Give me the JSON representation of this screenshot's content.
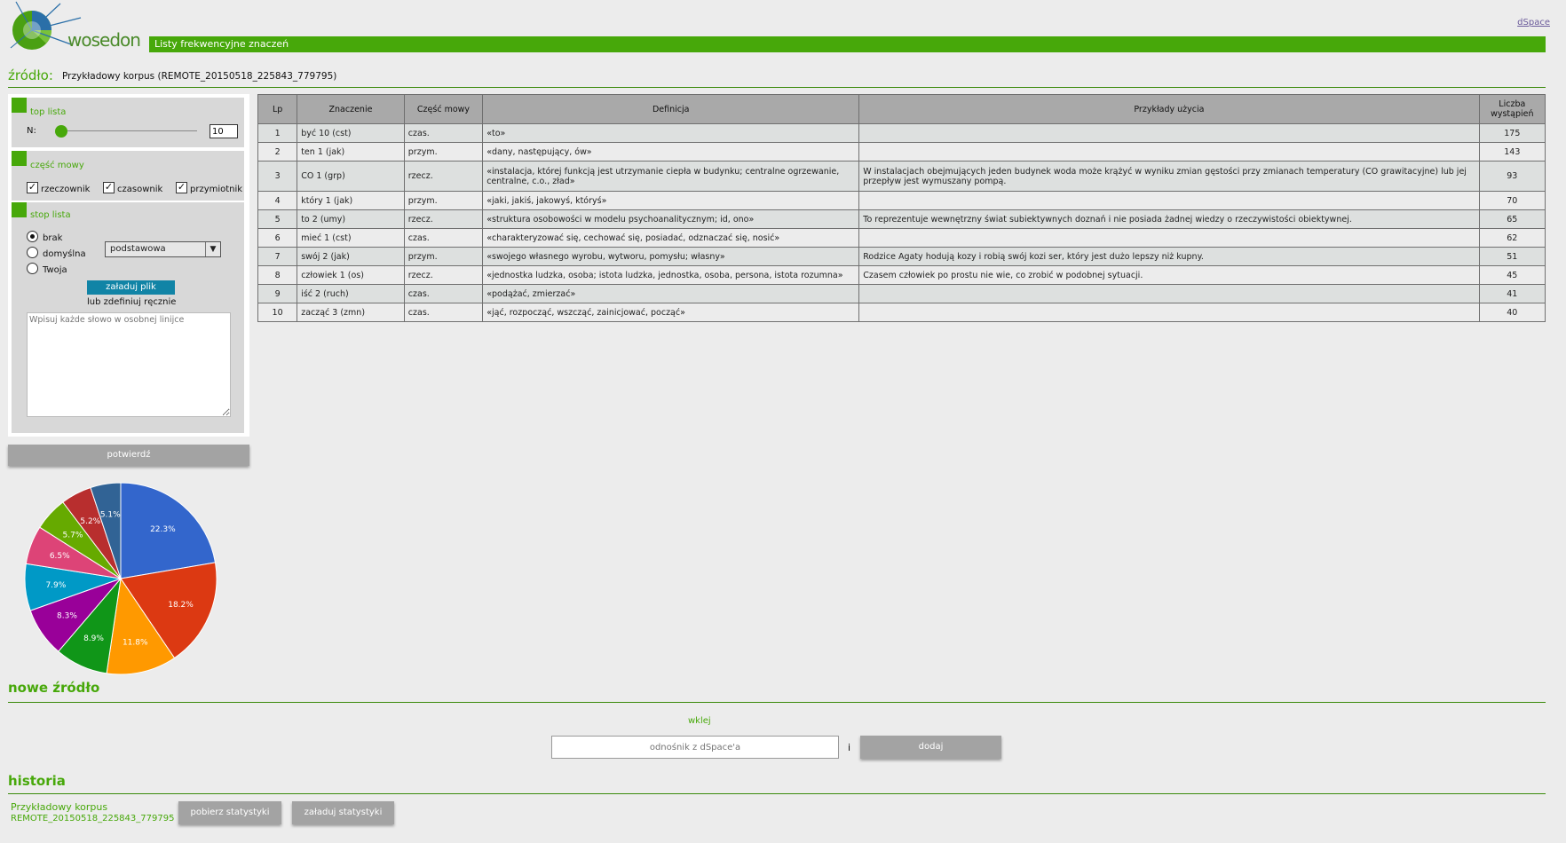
{
  "header": {
    "logo_text": "wosedon",
    "dspace_link": "dSpace",
    "title": "Listy frekwencyjne znaczeń"
  },
  "source": {
    "label": "źródło:",
    "value": "Przykładowy korpus (REMOTE_20150518_225843_779795)"
  },
  "panel": {
    "top_list": {
      "title": "top lista",
      "n_label": "N:",
      "n_value": "10",
      "slider_fraction": 0.0
    },
    "pos": {
      "title": "część mowy",
      "items": [
        {
          "label": "rzeczownik",
          "checked": true
        },
        {
          "label": "czasownik",
          "checked": true
        },
        {
          "label": "przymiotnik",
          "checked": true
        }
      ]
    },
    "stop_list": {
      "title": "stop lista",
      "options": [
        "brak",
        "domyślna",
        "Twoja"
      ],
      "selected": "brak",
      "select_value": "podstawowa",
      "upload_button": "załaduj plik",
      "define_label": "lub zdefiniuj ręcznie",
      "textarea_placeholder": "Wpisuj każde słowo w osobnej linijce"
    },
    "confirm_button": "potwierdź"
  },
  "table": {
    "headers": [
      "Lp",
      "Znaczenie",
      "Część mowy",
      "Definicja",
      "Przykłady użycia",
      "Liczba wystąpień"
    ],
    "rows": [
      [
        "1",
        "być 10 (cst)",
        "czas.",
        "«to»",
        "",
        "175"
      ],
      [
        "2",
        "ten 1 (jak)",
        "przym.",
        "«dany, następujący, ów»",
        "",
        "143"
      ],
      [
        "3",
        "CO 1 (grp)",
        "rzecz.",
        "«instalacja, której funkcją jest utrzymanie ciepła w budynku; centralne ogrzewanie, centralne, c.o., zład»",
        "W instalacjach obejmujących jeden budynek woda może krążyć w wyniku zmian gęstości przy zmianach temperatury (CO grawitacyjne) lub jej przepływ jest wymuszany pompą.",
        "93"
      ],
      [
        "4",
        "który 1 (jak)",
        "przym.",
        "«jaki, jakiś, jakowyś, któryś»",
        "",
        "70"
      ],
      [
        "5",
        "to 2 (umy)",
        "rzecz.",
        "«struktura osobowości w modelu psychoanalitycznym; id, ono»",
        "To reprezentuje wewnętrzny świat subiektywnych doznań i nie posiada żadnej wiedzy o rzeczywistości obiektywnej.",
        "65"
      ],
      [
        "6",
        "mieć 1 (cst)",
        "czas.",
        "«charakteryzować się, cechować się, posiadać, odznaczać się, nosić»",
        "",
        "62"
      ],
      [
        "7",
        "swój 2 (jak)",
        "przym.",
        "«swojego własnego wyrobu, wytworu, pomysłu; własny»",
        "Rodzice Agaty hodują kozy i robią swój kozi ser, który jest dużo lepszy niż kupny.",
        "51"
      ],
      [
        "8",
        "człowiek 1 (os)",
        "rzecz.",
        "«jednostka ludzka, osoba; istota ludzka, jednostka, osoba, persona, istota rozumna»",
        "Czasem człowiek po prostu nie wie, co zrobić w podobnej sytuacji.",
        "45"
      ],
      [
        "9",
        "iść 2 (ruch)",
        "czas.",
        "«podążać, zmierzać»",
        "",
        "41"
      ],
      [
        "10",
        "zacząć 3 (zmn)",
        "czas.",
        "«jąć, rozpocząć, wszcząć, zainicjować, począć»",
        "",
        "40"
      ]
    ]
  },
  "chart_data": {
    "type": "pie",
    "labels": [
      "być 10 (cst)",
      "ten 1 (jak)",
      "CO 1 (grp)",
      "który 1 (jak)",
      "to 2 (umy)",
      "mieć 1 (cst)",
      "swój 2 (jak)",
      "człowiek 1 (os)",
      "iść 2 (ruch)",
      "zacząć 3 (zmn)"
    ],
    "values": [
      22.3,
      18.2,
      11.8,
      8.9,
      8.3,
      7.9,
      6.5,
      5.7,
      5.2,
      5.1
    ],
    "value_labels": [
      "22.3%",
      "18.2%",
      "11.8%",
      "8.9%",
      "8.3%",
      "7.9%",
      "6.5%",
      "5.7%",
      "5.2%",
      "5.1%"
    ],
    "colors": [
      "#3366cc",
      "#dc3912",
      "#ff9900",
      "#109618",
      "#990099",
      "#0099c6",
      "#dd4477",
      "#66aa00",
      "#b82e2e",
      "#316395"
    ]
  },
  "new_source": {
    "title": "nowe źródło",
    "paste_label": "wklej",
    "input_placeholder": "odnośnik z dSpace'a",
    "and_label": "i",
    "add_button": "dodaj"
  },
  "history": {
    "title": "historia",
    "item_name": "Przykładowy korpus",
    "item_id": "REMOTE_20150518_225843_779795",
    "download_button": "pobierz statystyki",
    "load_button": "załaduj statystyki"
  },
  "colors": {
    "accent": "#47a80a",
    "button_gray": "#a3a3a3",
    "upload_button": "#1184a6"
  }
}
